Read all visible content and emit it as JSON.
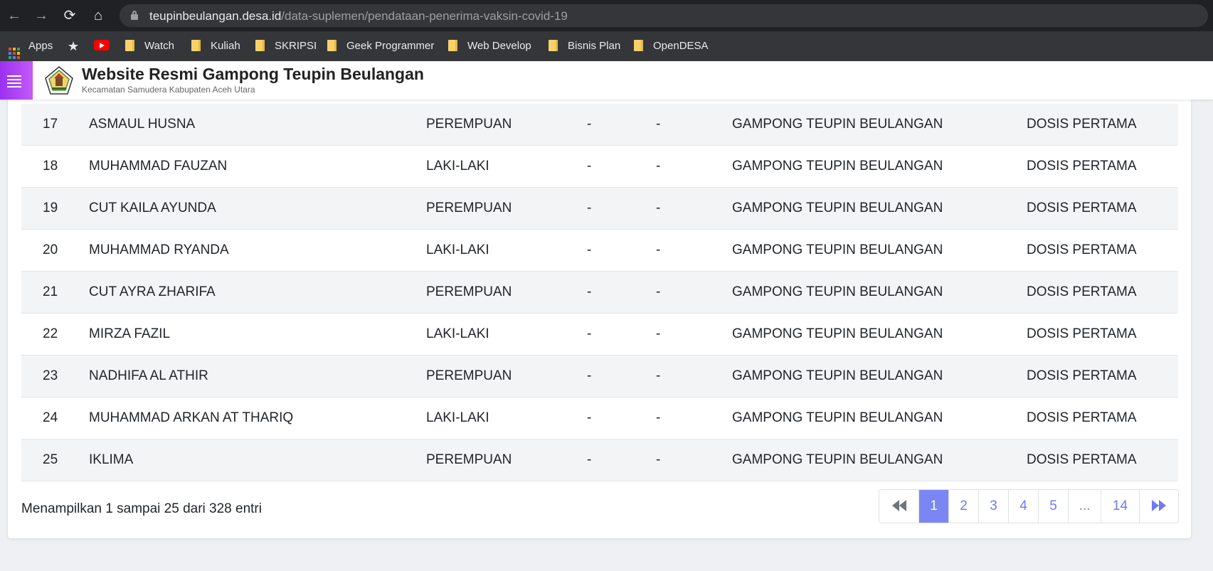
{
  "browser": {
    "url_domain": "teupinbeulangan.desa.id",
    "url_path": "/data-suplemen/pendataan-penerima-vaksin-covid-19",
    "bookmarks": [
      {
        "label": "Apps",
        "icon": "apps-grid-icon"
      },
      {
        "label": "Watch",
        "icon": "folder-icon"
      },
      {
        "label": "Kuliah",
        "icon": "folder-icon"
      },
      {
        "label": "SKRIPSI",
        "icon": "folder-icon"
      },
      {
        "label": "Geek Programmer",
        "icon": "folder-icon"
      },
      {
        "label": "Web Develop",
        "icon": "folder-icon"
      },
      {
        "label": "Bisnis Plan",
        "icon": "folder-icon"
      },
      {
        "label": "OpenDESA",
        "icon": "folder-icon"
      }
    ]
  },
  "site": {
    "title": "Website Resmi Gampong Teupin Beulangan",
    "subtitle": "Kecamatan Samudera  Kabupaten Aceh Utara",
    "accent": "#a33ff3"
  },
  "table": {
    "rows": [
      {
        "no": "17",
        "nama": "ASMAUL HUSNA",
        "jk": "PEREMPUAN",
        "a": "-",
        "b": "-",
        "desa": "GAMPONG TEUPIN BEULANGAN",
        "status": "DOSIS PERTAMA"
      },
      {
        "no": "18",
        "nama": "MUHAMMAD FAUZAN",
        "jk": "LAKI-LAKI",
        "a": "-",
        "b": "-",
        "desa": "GAMPONG TEUPIN BEULANGAN",
        "status": "DOSIS PERTAMA"
      },
      {
        "no": "19",
        "nama": "CUT KAILA AYUNDA",
        "jk": "PEREMPUAN",
        "a": "-",
        "b": "-",
        "desa": "GAMPONG TEUPIN BEULANGAN",
        "status": "DOSIS PERTAMA"
      },
      {
        "no": "20",
        "nama": "MUHAMMAD RYANDA",
        "jk": "LAKI-LAKI",
        "a": "-",
        "b": "-",
        "desa": "GAMPONG TEUPIN BEULANGAN",
        "status": "DOSIS PERTAMA"
      },
      {
        "no": "21",
        "nama": "CUT AYRA ZHARIFA",
        "jk": "PEREMPUAN",
        "a": "-",
        "b": "-",
        "desa": "GAMPONG TEUPIN BEULANGAN",
        "status": "DOSIS PERTAMA"
      },
      {
        "no": "22",
        "nama": "MIRZA FAZIL",
        "jk": "LAKI-LAKI",
        "a": "-",
        "b": "-",
        "desa": "GAMPONG TEUPIN BEULANGAN",
        "status": "DOSIS PERTAMA"
      },
      {
        "no": "23",
        "nama": "NADHIFA AL ATHIR",
        "jk": "PEREMPUAN",
        "a": "-",
        "b": "-",
        "desa": "GAMPONG TEUPIN BEULANGAN",
        "status": "DOSIS PERTAMA"
      },
      {
        "no": "24",
        "nama": "MUHAMMAD ARKAN AT THARIQ",
        "jk": "LAKI-LAKI",
        "a": "-",
        "b": "-",
        "desa": "GAMPONG TEUPIN BEULANGAN",
        "status": "DOSIS PERTAMA"
      },
      {
        "no": "25",
        "nama": "IKLIMA",
        "jk": "PEREMPUAN",
        "a": "-",
        "b": "-",
        "desa": "GAMPONG TEUPIN BEULANGAN",
        "status": "DOSIS PERTAMA"
      }
    ]
  },
  "footer": {
    "info": "Menampilkan 1 sampai 25 dari 328 entri"
  },
  "pagination": {
    "first_icon": "double-chevron-left-icon",
    "pages": [
      "1",
      "2",
      "3",
      "4",
      "5",
      "...",
      "14"
    ],
    "active": "1",
    "last_icon": "double-chevron-right-icon"
  }
}
